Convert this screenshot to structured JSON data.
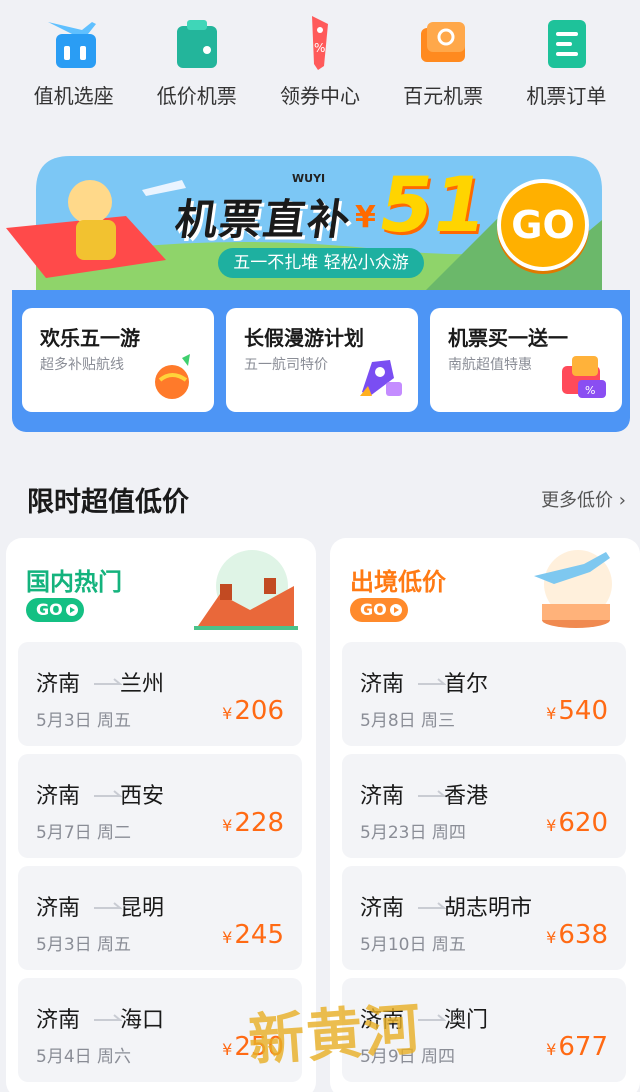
{
  "nav": {
    "items": [
      {
        "label": "值机选座",
        "icon": "seat-checkin-icon",
        "color": "#2a9df4"
      },
      {
        "label": "低价机票",
        "icon": "wallet-icon",
        "color": "#23b59b"
      },
      {
        "label": "领券中心",
        "icon": "coupon-tag-icon",
        "color": "#ff5a5a"
      },
      {
        "label": "百元机票",
        "icon": "ticket-icon",
        "color": "#ff8a1f"
      },
      {
        "label": "机票订单",
        "icon": "order-list-icon",
        "color": "#1ec29a"
      }
    ]
  },
  "banner": {
    "title": "机票直补",
    "currency": "¥",
    "amount": "51",
    "brand": "WUYI",
    "subtitle": "五一不扎堆 轻松小众游",
    "go_label": "GO"
  },
  "promos": [
    {
      "title": "欢乐五一游",
      "subtitle": "超多补贴航线",
      "icon": "fruit-gift-icon"
    },
    {
      "title": "长假漫游计划",
      "subtitle": "五一航司特价",
      "icon": "rocket-icon"
    },
    {
      "title": "机票买一送一",
      "subtitle": "南航超值特惠",
      "icon": "gift-coupon-icon"
    }
  ],
  "section": {
    "title": "限时超值低价",
    "more": "更多低价"
  },
  "domestic": {
    "title": "国内热门",
    "go_label": "GO",
    "routes": [
      {
        "from": "济南",
        "to": "兰州",
        "date": "5月3日 周五",
        "price": "206"
      },
      {
        "from": "济南",
        "to": "西安",
        "date": "5月7日 周二",
        "price": "228"
      },
      {
        "from": "济南",
        "to": "昆明",
        "date": "5月3日 周五",
        "price": "245"
      },
      {
        "from": "济南",
        "to": "海口",
        "date": "5月4日 周六",
        "price": "250"
      }
    ]
  },
  "international": {
    "title": "出境低价",
    "go_label": "GO",
    "routes": [
      {
        "from": "济南",
        "to": "首尔",
        "date": "5月8日 周三",
        "price": "540"
      },
      {
        "from": "济南",
        "to": "香港",
        "date": "5月23日 周四",
        "price": "620"
      },
      {
        "from": "济南",
        "to": "胡志明市",
        "date": "5月10日 周五",
        "price": "638"
      },
      {
        "from": "济南",
        "to": "澳门",
        "date": "5月9日 周四",
        "price": "677"
      }
    ]
  },
  "price_currency": "¥",
  "watermark": "新黄河",
  "colors": {
    "accent_green": "#14b37d",
    "accent_orange": "#ff7a14",
    "promo_blue": "#4d95f5",
    "price": "#ff6a14"
  }
}
